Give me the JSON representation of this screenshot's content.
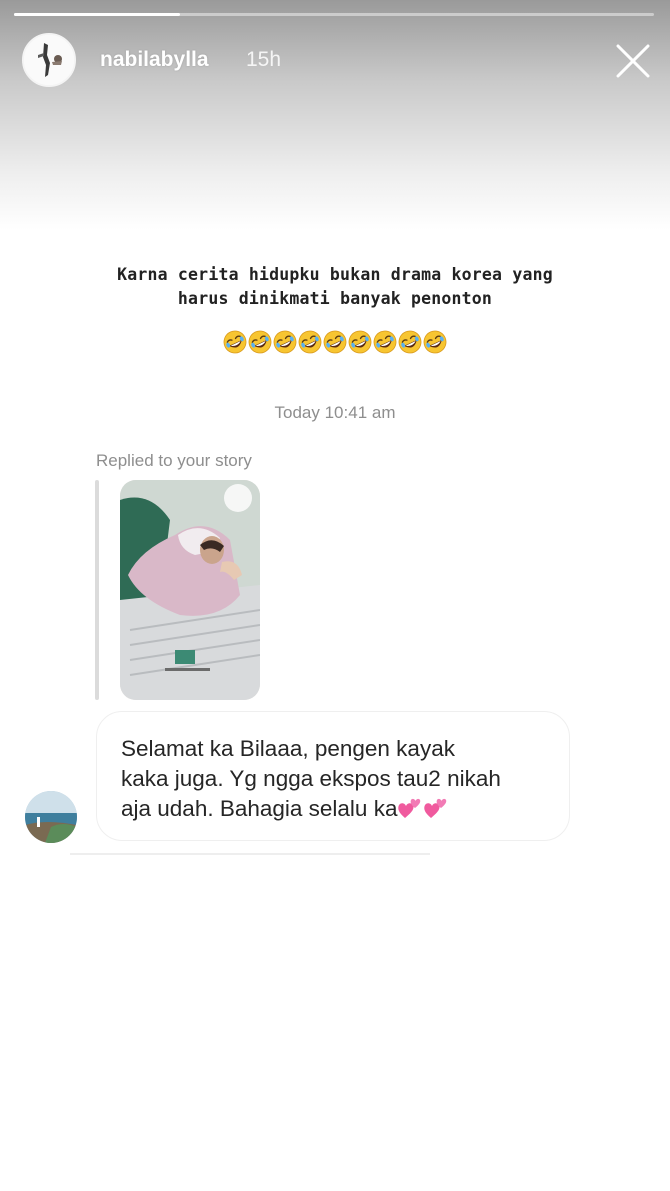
{
  "story": {
    "username": "nabilabylla",
    "time_ago": "15h",
    "progress": 0.26
  },
  "caption": {
    "line1": "Karna cerita hidupku bukan drama korea yang",
    "line2": "harus dinikmati banyak penonton",
    "emoji_name": "rolling-on-floor-laughing",
    "emoji_count": 9
  },
  "conversation": {
    "timestamp": "Today 10:41 am",
    "replied_label": "Replied to your story",
    "message": {
      "line1": "Selamat ka Bilaaa, pengen kayak",
      "line2": "kaka juga. Yg ngga ekspos tau2 nikah",
      "line3": "aja udah. Bahagia selalu ka"
    }
  },
  "icons": {
    "close": "close-icon",
    "heart": "two-hearts-icon"
  },
  "colors": {
    "text_primary": "#262626",
    "text_secondary": "#8e8e8e",
    "heart_pink": "#f05a9e"
  }
}
